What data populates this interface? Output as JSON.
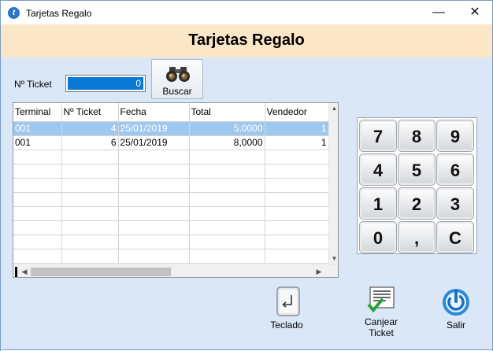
{
  "window": {
    "title": "Tarjetas Regalo",
    "minimize": "—",
    "close": "✕",
    "app_icon_letter": "t"
  },
  "header": {
    "title": "Tarjetas Regalo"
  },
  "search": {
    "ticket_label": "Nº Ticket",
    "ticket_value": "0",
    "search_button": "Buscar"
  },
  "grid": {
    "columns": [
      "Terminal",
      "Nº Ticket",
      "Fecha",
      "Total",
      "Vendedor"
    ],
    "rows": [
      {
        "terminal": "001",
        "ticket": "4",
        "fecha": "25/01/2019",
        "total": "5,0000",
        "vendedor": "1"
      },
      {
        "terminal": "001",
        "ticket": "6",
        "fecha": "25/01/2019",
        "total": "8,0000",
        "vendedor": "1"
      }
    ],
    "selected_row": 0
  },
  "keypad": {
    "keys": [
      "7",
      "8",
      "9",
      "4",
      "5",
      "6",
      "1",
      "2",
      "3",
      "0",
      ",",
      "C"
    ]
  },
  "actions": {
    "teclado": "Teclado",
    "canjear_line1": "Canjear",
    "canjear_line2": "Ticket",
    "salir": "Salir"
  },
  "colors": {
    "header_bg": "#fbe6c8",
    "main_bg": "#dae7f7",
    "selected_row": "#9ec8ee",
    "input_selection": "#0a78d7"
  }
}
